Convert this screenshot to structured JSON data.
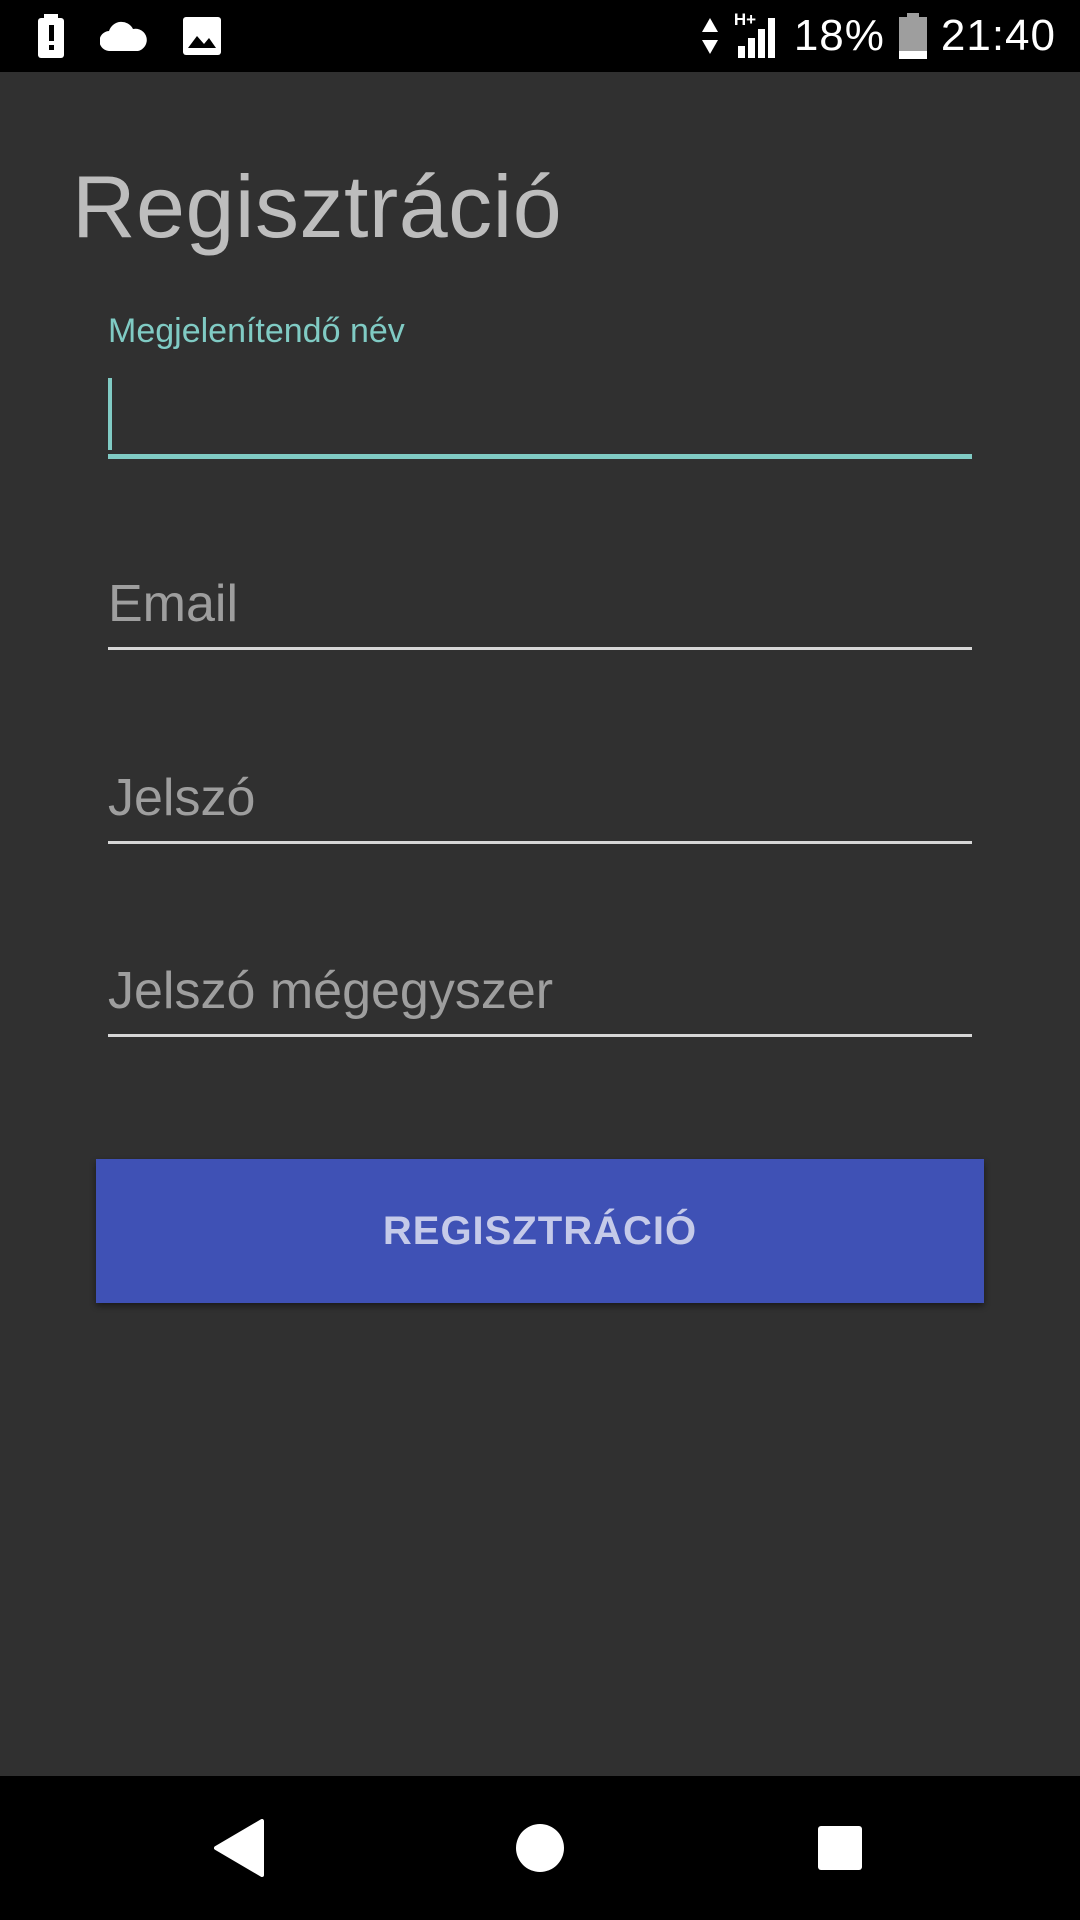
{
  "status_bar": {
    "battery_percent": "18%",
    "time": "21:40",
    "network_type": "H+",
    "icons": [
      "alert-icon",
      "cloud-icon",
      "image-icon",
      "data-arrows-icon",
      "signal-icon",
      "battery-icon"
    ]
  },
  "page": {
    "title": "Regisztráció"
  },
  "form": {
    "display_name": {
      "label": "Megjelenítendő név",
      "value": ""
    },
    "email": {
      "placeholder": "Email"
    },
    "password": {
      "placeholder": "Jelszó"
    },
    "password_confirm": {
      "placeholder": "Jelszó mégegyszer"
    }
  },
  "buttons": {
    "register_label": "REGISZTRÁCIÓ"
  },
  "nav_bar": {
    "icons": [
      "back-icon",
      "home-icon",
      "recents-icon"
    ]
  },
  "colors": {
    "background": "#303030",
    "accent": "#80cbc4",
    "button": "#3f51b5",
    "button_text": "#c5cae9"
  }
}
